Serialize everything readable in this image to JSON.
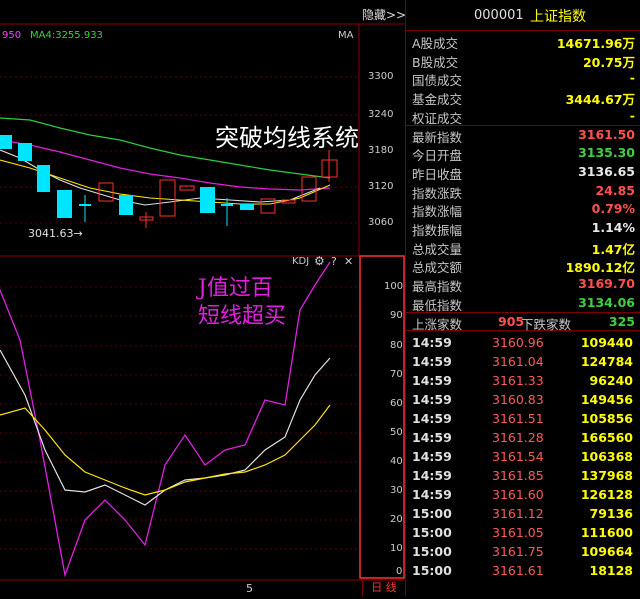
{
  "toolbar": {
    "hide_label": "隐藏>>",
    "ma_prefix": "950",
    "ma4_label": "MA4:3255.933",
    "ma_right": "MA"
  },
  "annotations": {
    "breakout": "突破均线系统",
    "jvalue_line1": "J值过百",
    "jvalue_line2": "短线超买",
    "low_marker": "3041.63→"
  },
  "price_axis": [
    "3300",
    "3240",
    "3180",
    "3120",
    "3060"
  ],
  "kdj": {
    "title": "KDJ",
    "gear_icon": "gear-icon",
    "help_glyph": "?",
    "close_glyph": "✕",
    "axis": [
      "100",
      "90",
      "80",
      "70",
      "60",
      "50",
      "40",
      "30",
      "20",
      "10",
      "0"
    ]
  },
  "bottom": {
    "period_marker": "5",
    "daily_tab": "日 线"
  },
  "right_panel": {
    "code": "000001",
    "name": "上证指数",
    "stats": [
      {
        "label": "A股成交",
        "value": "14671.96万",
        "color": "yellow"
      },
      {
        "label": "B股成交",
        "value": "20.75万",
        "color": "yellow"
      },
      {
        "label": "国债成交",
        "value": "-",
        "color": "yellow"
      },
      {
        "label": "基金成交",
        "value": "3444.67万",
        "color": "yellow"
      },
      {
        "label": "权证成交",
        "value": "-",
        "color": "yellow"
      },
      {
        "label": "最新指数",
        "value": "3161.50",
        "color": "red"
      },
      {
        "label": "今日开盘",
        "value": "3135.30",
        "color": "green"
      },
      {
        "label": "昨日收盘",
        "value": "3136.65",
        "color": "white"
      },
      {
        "label": "指数涨跌",
        "value": "24.85",
        "color": "red"
      },
      {
        "label": "指数涨幅",
        "value": "0.79%",
        "color": "red"
      },
      {
        "label": "指数振幅",
        "value": "1.14%",
        "color": "white"
      },
      {
        "label": "总成交量",
        "value": "1.47亿",
        "color": "yellow"
      },
      {
        "label": "总成交额",
        "value": "1890.12亿",
        "color": "yellow"
      },
      {
        "label": "最高指数",
        "value": "3169.70",
        "color": "red"
      },
      {
        "label": "最低指数",
        "value": "3134.06",
        "color": "green"
      }
    ],
    "updown": {
      "up_label": "上涨家数",
      "up_value": "905",
      "down_label": "下跌家数",
      "down_value": "325"
    },
    "ticks": [
      {
        "time": "14:59",
        "price": "3160.96",
        "vol": "109440"
      },
      {
        "time": "14:59",
        "price": "3161.04",
        "vol": "124784"
      },
      {
        "time": "14:59",
        "price": "3161.33",
        "vol": "96240"
      },
      {
        "time": "14:59",
        "price": "3160.83",
        "vol": "149456"
      },
      {
        "time": "14:59",
        "price": "3161.51",
        "vol": "105856"
      },
      {
        "time": "14:59",
        "price": "3161.28",
        "vol": "166560"
      },
      {
        "time": "14:59",
        "price": "3161.54",
        "vol": "106368"
      },
      {
        "time": "14:59",
        "price": "3161.85",
        "vol": "137968"
      },
      {
        "time": "14:59",
        "price": "3161.60",
        "vol": "126128"
      },
      {
        "time": "15:00",
        "price": "3161.12",
        "vol": "79136"
      },
      {
        "time": "15:00",
        "price": "3161.05",
        "vol": "111600"
      },
      {
        "time": "15:00",
        "price": "3161.75",
        "vol": "109664"
      },
      {
        "time": "15:00",
        "price": "3161.61",
        "vol": "18128"
      }
    ]
  }
}
